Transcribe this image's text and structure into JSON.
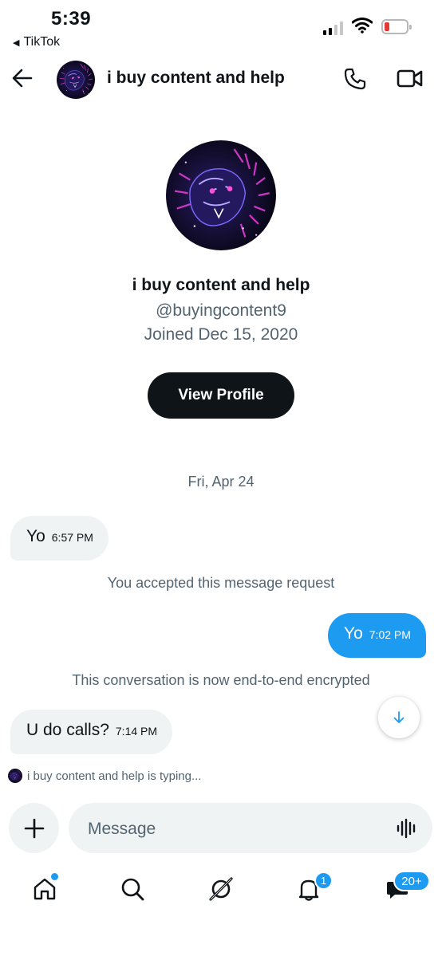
{
  "status_bar": {
    "time": "5:39",
    "back_app": "TikTok"
  },
  "header": {
    "title": "i buy content and help"
  },
  "profile": {
    "name": "i buy content and help",
    "handle": "@buyingcontent9",
    "joined": "Joined Dec 15, 2020",
    "view_profile_label": "View Profile"
  },
  "conversation": {
    "date_separator": "Fri, Apr 24",
    "messages": [
      {
        "direction": "incoming",
        "text": "Yo",
        "time": "6:57 PM"
      },
      {
        "direction": "notice",
        "text": "You accepted this message request"
      },
      {
        "direction": "outgoing",
        "text": "Yo",
        "time": "7:02 PM"
      },
      {
        "direction": "notice",
        "text": "This conversation is now end-to-end encrypted"
      },
      {
        "direction": "incoming",
        "text": "U do calls?",
        "time": "7:14 PM"
      }
    ],
    "typing_indicator": "i buy content and help is typing..."
  },
  "composer": {
    "placeholder": "Message"
  },
  "tab_bar": {
    "items": [
      "home-icon",
      "search-icon",
      "grok-icon",
      "bell-icon",
      "envelope-icon"
    ],
    "notifications_badge": "1",
    "messages_badge": "20+"
  },
  "colors": {
    "accent": "#1d9bf0",
    "text": "#0f1419",
    "secondary_text": "#536471",
    "bubble_incoming": "#eff3f4"
  }
}
